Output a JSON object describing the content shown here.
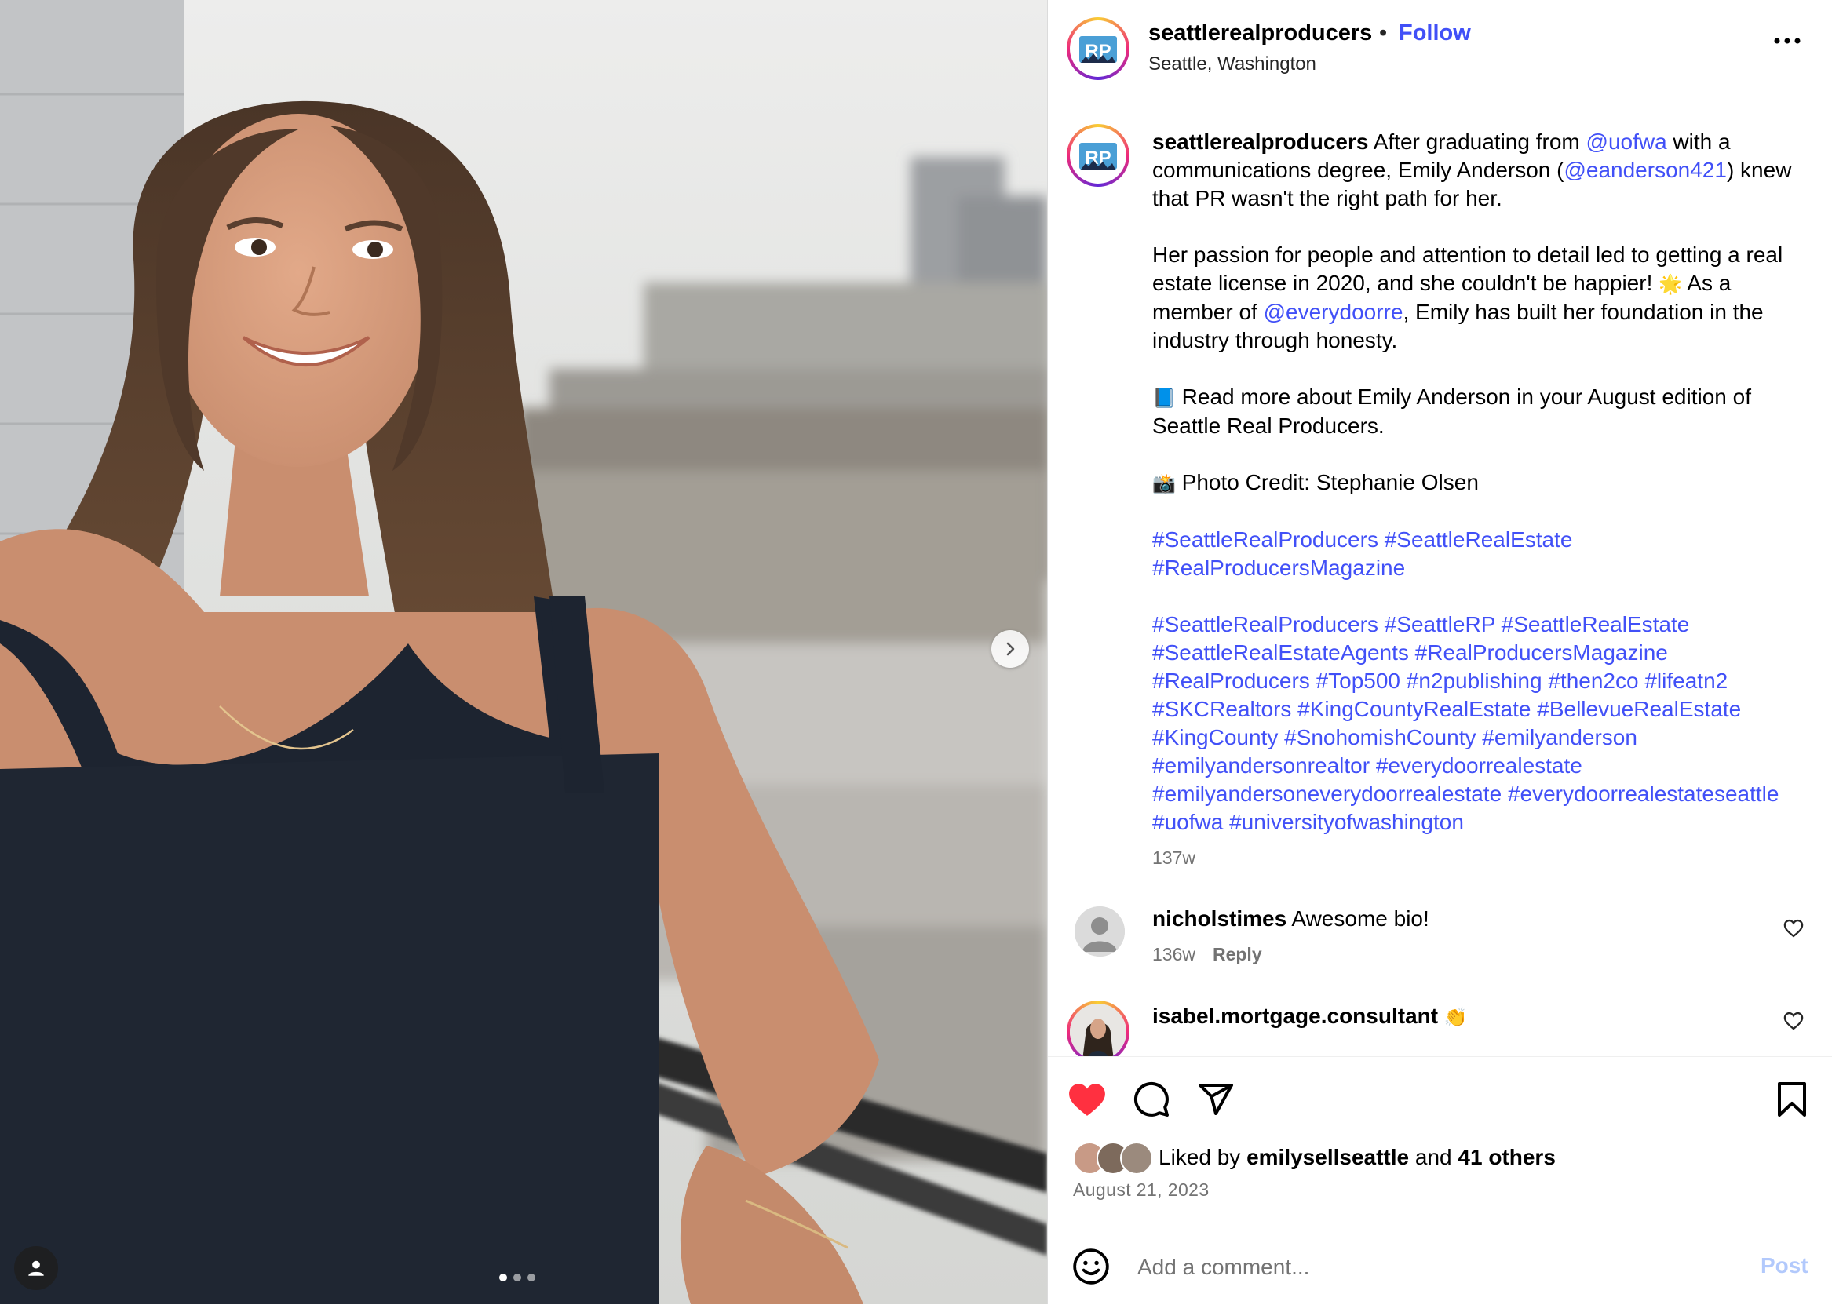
{
  "post": {
    "username": "seattlerealproducers",
    "separator": "•",
    "follow_label": "Follow",
    "location": "Seattle, Washington",
    "more_label": "More options"
  },
  "caption": {
    "username": "seattlerealproducers",
    "p1_a": " After graduating from ",
    "p1_mention1": "@uofwa",
    "p1_b": " with a communications degree, Emily Anderson (",
    "p1_mention2": "@eanderson421",
    "p1_c": ") knew that PR wasn't the right path for her.",
    "p2_a": "Her passion for people and attention to detail led to getting a real estate license in 2020, and she couldn't be happier! ",
    "p2_emoji": "🌟",
    "p2_b": " As a member of ",
    "p2_mention": "@everydoorre",
    "p2_c": ", Emily has built her foundation in the industry through honesty.",
    "p3_emoji": "📘",
    "p3_text": " Read more about Emily Anderson in your August edition of Seattle Real Producers.",
    "p4_emoji": "📸",
    "p4_text": " Photo Credit: Stephanie Olsen",
    "hashtags_1": "#SeattleRealProducers #SeattleRealEstate #RealProducersMagazine",
    "hashtags_2": "#SeattleRealProducers #SeattleRP #SeattleRealEstate #SeattleRealEstateAgents #RealProducersMagazine #RealProducers #Top500 #n2publishing #then2co #lifeatn2 #SKCRealtors #KingCountyRealEstate #BellevueRealEstate #KingCounty #SnohomishCounty #emilyanderson #emilyandersonrealtor #everydoorrealestate #emilyandersoneverydoorrealestate #everydoorrealestateseattle #uofwa #universityofwashington",
    "time": "137w"
  },
  "comments": [
    {
      "username": "nicholstimes",
      "text": " Awesome bio!",
      "time": "136w",
      "reply_label": "Reply"
    },
    {
      "username": "isabel.mortgage.consultant",
      "text": " 👏"
    }
  ],
  "likes": {
    "prefix": "Liked by ",
    "user": "emilysellseattle",
    "middle": " and ",
    "others": "41 others",
    "date": "August 21, 2023"
  },
  "comment_box": {
    "placeholder": "Add a comment...",
    "post_label": "Post"
  },
  "icons": {
    "like": "heart-filled-icon",
    "comment": "comment-bubble-icon",
    "share": "paper-plane-icon",
    "save": "bookmark-icon",
    "emoji": "smiley-icon",
    "more": "ellipsis-icon",
    "next": "chevron-right-icon",
    "tags": "person-icon"
  },
  "colors": {
    "link": "#4150f7",
    "like_red": "#ff3040",
    "post_disabled": "#b2c9fc",
    "muted": "#737373"
  }
}
